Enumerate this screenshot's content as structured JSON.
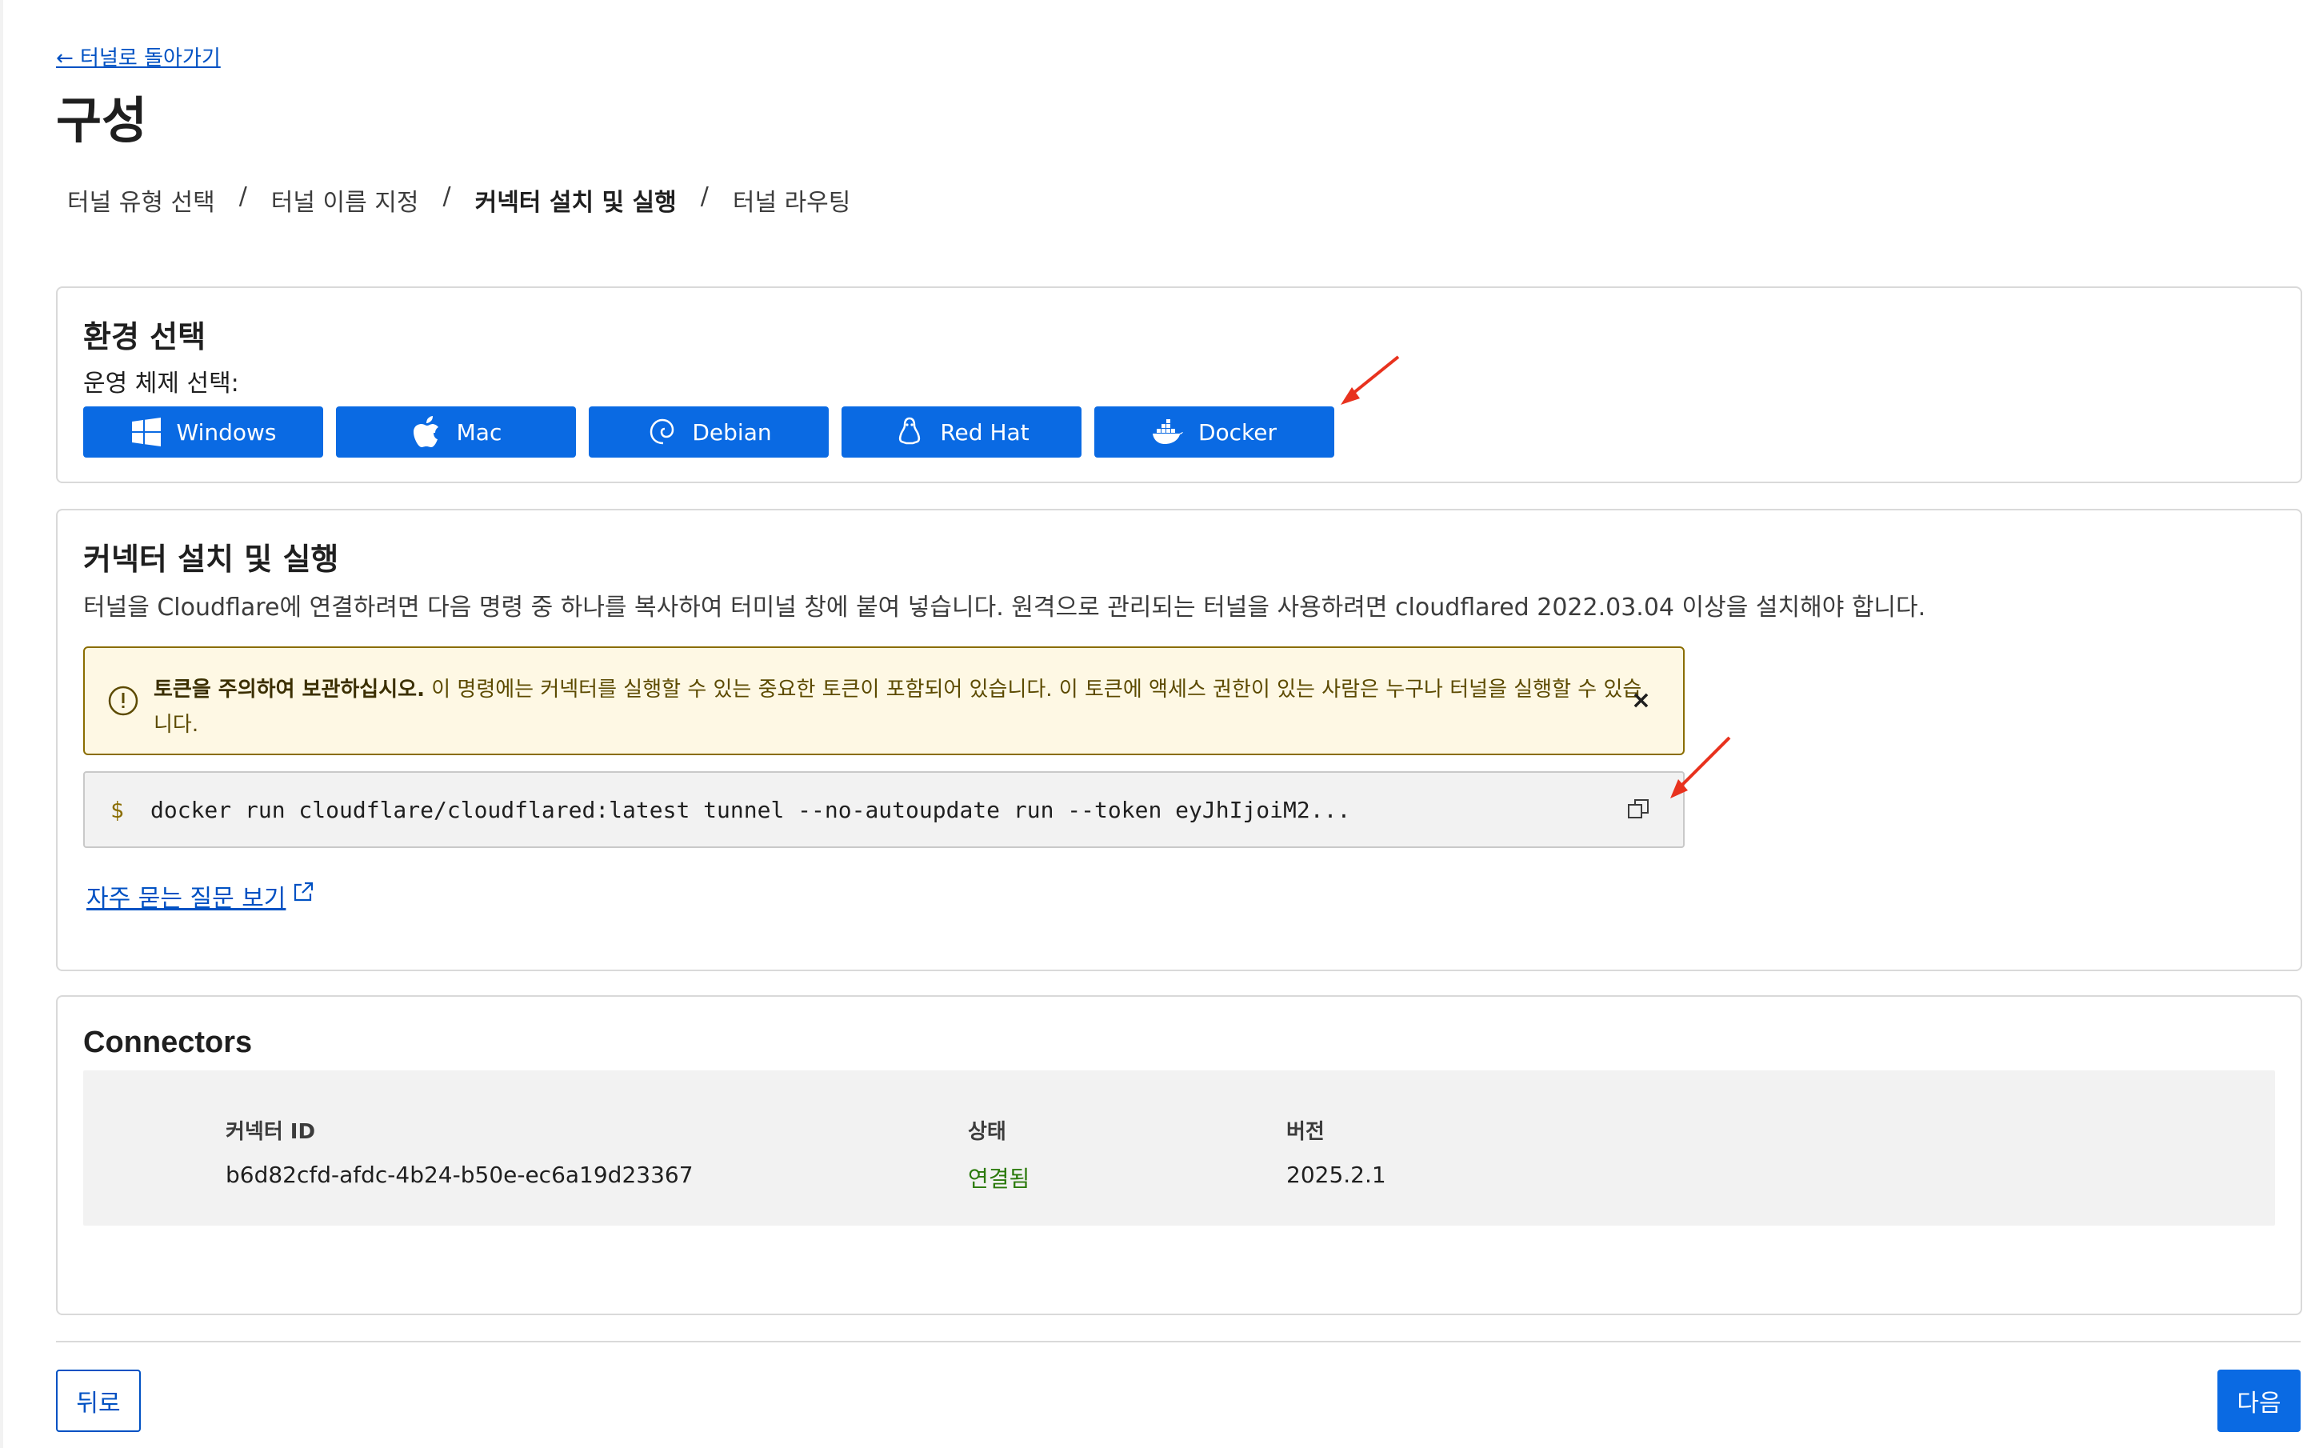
{
  "nav": {
    "back_link": "← 터널로 돌아가기"
  },
  "page": {
    "title": "구성"
  },
  "steps": [
    {
      "label": "터널 유형 선택",
      "active": false
    },
    {
      "label": "터널 이름 지정",
      "active": false
    },
    {
      "label": "커넥터 설치 및 실행",
      "active": true
    },
    {
      "label": "터널 라우팅",
      "active": false
    }
  ],
  "steps_separator": "/",
  "environment": {
    "title": "환경 선택",
    "os_label": "운영 체제 선택:",
    "buttons": [
      {
        "label": "Windows",
        "icon": "windows-icon"
      },
      {
        "label": "Mac",
        "icon": "apple-icon"
      },
      {
        "label": "Debian",
        "icon": "debian-icon"
      },
      {
        "label": "Red Hat",
        "icon": "linux-tux-icon"
      },
      {
        "label": "Docker",
        "icon": "docker-icon"
      }
    ]
  },
  "install": {
    "title": "커넥터 설치 및 실행",
    "description": "터널을 Cloudflare에 연결하려면 다음 명령 중 하나를 복사하여 터미널 창에 붙여 넣습니다. 원격으로 관리되는 터널을 사용하려면 cloudflared 2022.03.04 이상을 설치해야 합니다.",
    "warning_bold": "토큰을 주의하여 보관하십시오.",
    "warning_text": " 이 명령에는 커넥터를 실행할 수 있는 중요한 토큰이 포함되어 있습니다. 이 토큰에 액세스 권한이 있는 사람은 누구나 터널을 실행할 수 있습니다.",
    "warning_close": "×",
    "prompt": "$",
    "command": "docker run cloudflare/cloudflared:latest tunnel --no-autoupdate run --token eyJhIjoiM2...",
    "faq_link": "자주 묻는 질문 보기"
  },
  "connectors": {
    "title": "Connectors",
    "headers": {
      "id": "커넥터 ID",
      "status": "상태",
      "version": "버전"
    },
    "rows": [
      {
        "id": "b6d82cfd-afdc-4b24-b50e-ec6a19d23367",
        "status": "연결됨",
        "version": "2025.2.1"
      }
    ]
  },
  "footer": {
    "back": "뒤로",
    "next": "다음"
  },
  "colors": {
    "primary": "#0a6ae3",
    "link": "#0051c3",
    "warning_bg": "#fef8e4",
    "success": "#2b7a0b",
    "annotation_arrow": "#e8321e"
  }
}
